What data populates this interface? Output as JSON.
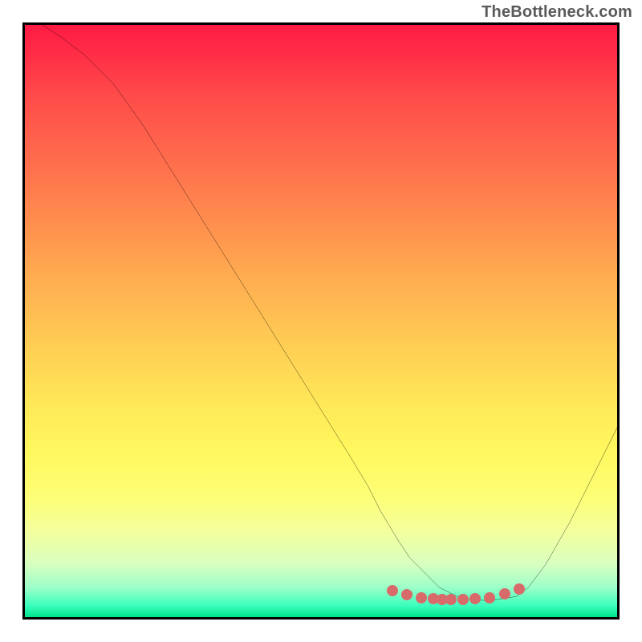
{
  "watermark": "TheBottleneck.com",
  "chart_data": {
    "type": "line",
    "title": "",
    "xlabel": "",
    "ylabel": "",
    "xlim": [
      0,
      100
    ],
    "ylim": [
      0,
      100
    ],
    "grid": false,
    "legend": false,
    "annotations": [],
    "series": [
      {
        "name": "curve",
        "x": [
          3,
          6,
          10,
          15,
          20,
          25,
          30,
          35,
          40,
          45,
          50,
          55,
          58,
          60,
          63,
          65,
          68,
          70,
          73,
          75,
          78,
          80,
          83,
          85,
          88,
          92,
          96,
          100
        ],
        "y": [
          100,
          98,
          95,
          90,
          83,
          75,
          67,
          59,
          51,
          43,
          35,
          27,
          22,
          18,
          13,
          10,
          7,
          5,
          3.5,
          3,
          2.8,
          3,
          3.5,
          5,
          9,
          16,
          24,
          32
        ]
      }
    ],
    "markers": {
      "name": "bottom-cluster",
      "x": [
        62,
        64.5,
        67,
        69,
        70.5,
        72,
        74,
        76,
        78.5,
        81,
        83.5
      ],
      "y": [
        4.5,
        3.8,
        3.3,
        3.1,
        3.0,
        3.0,
        3.0,
        3.1,
        3.3,
        3.9,
        4.8
      ]
    },
    "colors": {
      "curve": "#000000",
      "marker": "#d96a6a",
      "frame": "#000000"
    }
  }
}
